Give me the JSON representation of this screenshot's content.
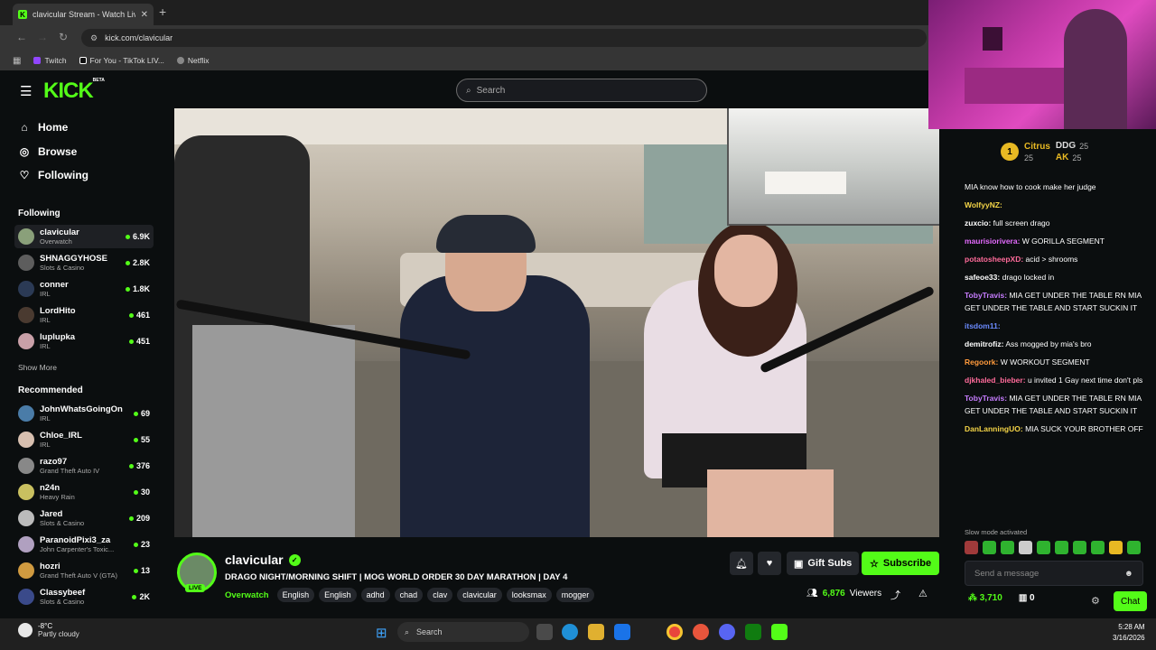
{
  "browser": {
    "tab_title": "clavicular Stream - Watch Live o",
    "url": "kick.com/clavicular",
    "bookmarks": [
      "Twitch",
      "For You - TikTok LIV...",
      "Netflix"
    ]
  },
  "header": {
    "logo": "KICK",
    "logo_badge": "BETA",
    "search_placeholder": "Search"
  },
  "sidebar": {
    "nav": [
      "Home",
      "Browse",
      "Following"
    ],
    "following_header": "Following",
    "following": [
      {
        "name": "clavicular",
        "category": "Overwatch",
        "viewers": "6.9K"
      },
      {
        "name": "SHNAGGYHOSE",
        "category": "Slots & Casino",
        "viewers": "2.8K"
      },
      {
        "name": "conner",
        "category": "IRL",
        "viewers": "1.8K"
      },
      {
        "name": "LordHito",
        "category": "IRL",
        "viewers": "461"
      },
      {
        "name": "luplupka",
        "category": "IRL",
        "viewers": "451"
      }
    ],
    "show_more": "Show More",
    "recommended_header": "Recommended",
    "recommended": [
      {
        "name": "JohnWhatsGoingOn",
        "category": "IRL",
        "viewers": "69"
      },
      {
        "name": "Chloe_IRL",
        "category": "IRL",
        "viewers": "55"
      },
      {
        "name": "razo97",
        "category": "Grand Theft Auto IV",
        "viewers": "376"
      },
      {
        "name": "n24n",
        "category": "Heavy Rain",
        "viewers": "30"
      },
      {
        "name": "Jared",
        "category": "Slots & Casino",
        "viewers": "209"
      },
      {
        "name": "ParanoidPixi3_za",
        "category": "John Carpenter's Toxic...",
        "viewers": "23"
      },
      {
        "name": "hozri",
        "category": "Grand Theft Auto V (GTA)",
        "viewers": "13"
      },
      {
        "name": "Classybeef",
        "category": "Slots & Casino",
        "viewers": "2K"
      }
    ]
  },
  "stream": {
    "streamer": "clavicular",
    "live_badge": "LIVE",
    "title": "DRAGO NIGHT/MORNING SHIFT | MOG WORLD ORDER 30 DAY MARATHON | DAY 4",
    "category": "Overwatch",
    "tags": [
      "English",
      "English",
      "adhd",
      "chad",
      "clav",
      "clavicular",
      "looksmax",
      "mogger"
    ],
    "gift_subs": "Gift Subs",
    "subscribe": "Subscribe",
    "viewers_count": "6,876",
    "viewers_label": "Viewers"
  },
  "chat": {
    "leaderboard": [
      {
        "rank": "1",
        "name": "Citrus",
        "value": "25"
      },
      {
        "name": "DDG",
        "value": "25"
      },
      {
        "name": "AK",
        "value": "25"
      }
    ],
    "messages": [
      {
        "user": "",
        "color": "#ff4b4b",
        "text": "MIA know how to cook make her judge"
      },
      {
        "user": "WolfyyNZ:",
        "color": "#f5d547",
        "text": ""
      },
      {
        "user": "zuxcio:",
        "color": "#ffffff",
        "text": "full screen drago"
      },
      {
        "user": "maurisiorivera:",
        "color": "#e56bff",
        "text": "W GORILLA SEGMENT"
      },
      {
        "user": "potatosheepXD:",
        "color": "#ff6b9a",
        "text": "acid > shrooms"
      },
      {
        "user": "safeoe33:",
        "color": "#ffffff",
        "text": "drago locked in"
      },
      {
        "user": "TobyTravis:",
        "color": "#c77dff",
        "text": "MIA GET UNDER THE TABLE RN MIA GET UNDER THE TABLE AND START SUCKIN IT"
      },
      {
        "user": "itsdom11:",
        "color": "#6b8bff",
        "text": ""
      },
      {
        "user": "",
        "color": "#ff4b4b",
        "text": ""
      },
      {
        "user": "demitrofiz:",
        "color": "#ffffff",
        "text": "Ass mogged by mia's bro"
      },
      {
        "user": "Regoork:",
        "color": "#ff9a3c",
        "text": "W WORKOUT SEGMENT"
      },
      {
        "user": "djkhaled_bieber:",
        "color": "#ff6b9a",
        "text": "u invited 1 Gay next time don't pls"
      },
      {
        "user": "TobyTravis:",
        "color": "#c77dff",
        "text": "MIA GET UNDER THE TABLE RN MIA GET UNDER THE TABLE AND START SUCKIN IT"
      },
      {
        "user": "DanLanningUO:",
        "color": "#f5d547",
        "text": "MIA SUCK YOUR BROTHER OFF"
      }
    ],
    "slow_mode": "Slow mode activated",
    "input_placeholder": "Send a message",
    "points": "3,710",
    "gift_count": "0",
    "chat_button": "Chat"
  },
  "taskbar": {
    "temperature": "-8°C",
    "weather": "Partly cloudy",
    "search": "Search",
    "time": "5:28 AM",
    "date": "3/16/2026"
  }
}
